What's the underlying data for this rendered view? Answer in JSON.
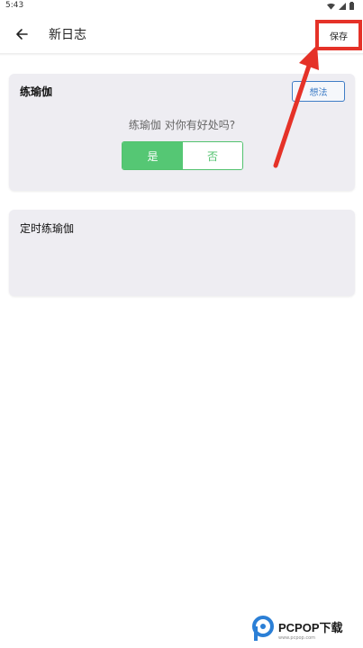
{
  "status_bar": {
    "time": "5:43"
  },
  "app_bar": {
    "title": "新日志",
    "save_label": "保存"
  },
  "habit_card": {
    "title": "练瑜伽",
    "idea_label": "想法",
    "question": "练瑜伽 对你有好处吗?",
    "yes_label": "是",
    "no_label": "否",
    "selected": "是"
  },
  "timed_card": {
    "title": "定时练瑜伽"
  },
  "watermark": {
    "brand": "PCPOP下载",
    "sub": "www.pcpop.com"
  },
  "colors": {
    "accent_green": "#55c774",
    "idea_blue": "#3f7dc6",
    "highlight_red": "#e53228",
    "card_bg": "#eeedf2"
  }
}
